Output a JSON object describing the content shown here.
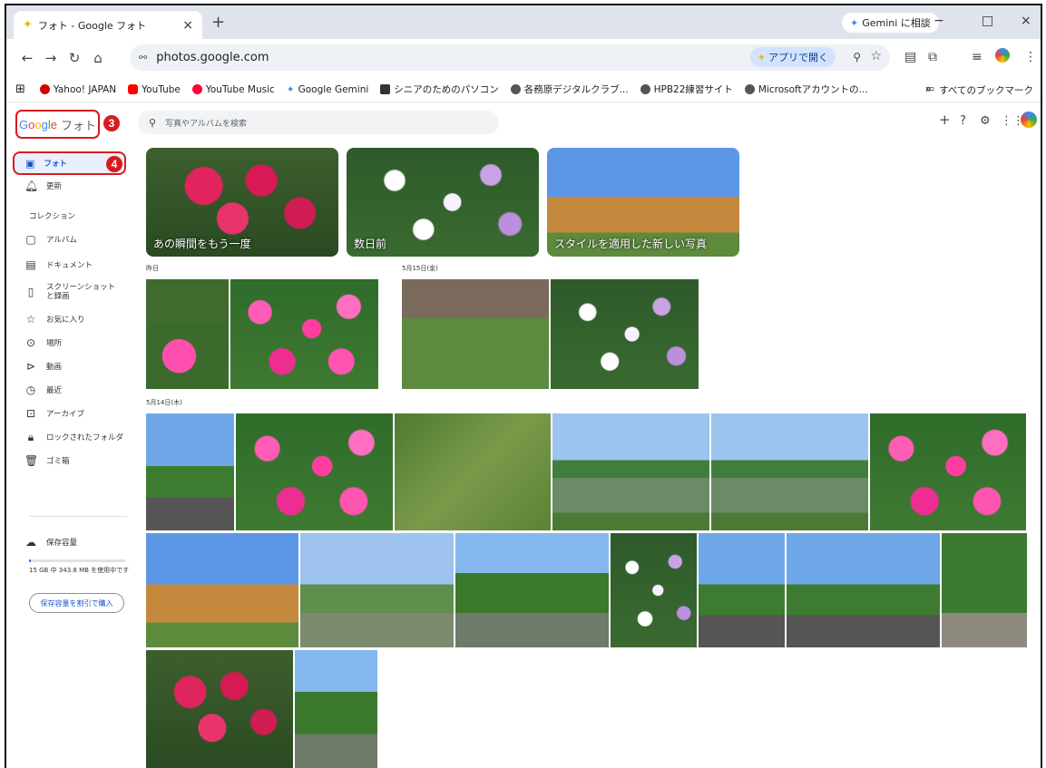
{
  "browser": {
    "tab_title": "フォト - Google フォト",
    "tab_close": "×",
    "new_tab": "+",
    "gemini_button": "Gemini に相談",
    "window_controls": [
      "−",
      "□",
      "×"
    ],
    "url": "photos.google.com",
    "open_app_button": "アプリで開く",
    "bookmarks": [
      {
        "label": "Yahoo! JAPAN",
        "color": "#d20000"
      },
      {
        "label": "YouTube",
        "color": "#ff0000"
      },
      {
        "label": "YouTube Music",
        "color": "#ff0033"
      },
      {
        "label": "Google Gemini",
        "color": "#4285f4"
      },
      {
        "label": "シニアのためのパソコン",
        "color": "#333333"
      },
      {
        "label": "各務原デジタルクラブ...",
        "color": "#555555"
      },
      {
        "label": "HPB22練習サイト",
        "color": "#555555"
      },
      {
        "label": "Microsoftアカウントの...",
        "color": "#555555"
      }
    ],
    "bookmarks_overflow": "»",
    "all_bookmarks": "すべてのブックマーク"
  },
  "app": {
    "logo_google": "Google",
    "logo_photos": "フォト",
    "annotation_3": "3",
    "annotation_4": "4",
    "search_placeholder": "写真やアルバムを検索"
  },
  "sidebar": {
    "items": [
      {
        "label": "フォト",
        "icon": "photo-icon"
      },
      {
        "label": "更新",
        "icon": "bell-icon"
      }
    ],
    "collections_header": "コレクション",
    "collections": [
      {
        "label": "アルバム",
        "icon": "album-icon"
      },
      {
        "label": "ドキュメント",
        "icon": "document-icon"
      },
      {
        "label": "スクリーンショットと録画",
        "icon": "screenshot-icon"
      },
      {
        "label": "お気に入り",
        "icon": "star-icon"
      },
      {
        "label": "場所",
        "icon": "pin-icon"
      },
      {
        "label": "動画",
        "icon": "play-icon"
      },
      {
        "label": "最近",
        "icon": "clock-icon"
      },
      {
        "label": "アーカイブ",
        "icon": "archive-icon"
      },
      {
        "label": "ロックされたフォルダ",
        "icon": "lock-icon"
      },
      {
        "label": "ゴミ箱",
        "icon": "trash-icon"
      }
    ],
    "storage_label": "保存容量",
    "storage_usage": "15 GB 中 343.8 MB を使用中です",
    "storage_fraction": 0.023,
    "buy_storage": "保存容量を割引で購入"
  },
  "main": {
    "memories": [
      "あの瞬間をもう一度",
      "数日前",
      "スタイルを適用した新しい写真"
    ],
    "date_yesterday": "昨日",
    "date_may15": "5月15日(金)",
    "date_may14": "5月14日(木)"
  }
}
